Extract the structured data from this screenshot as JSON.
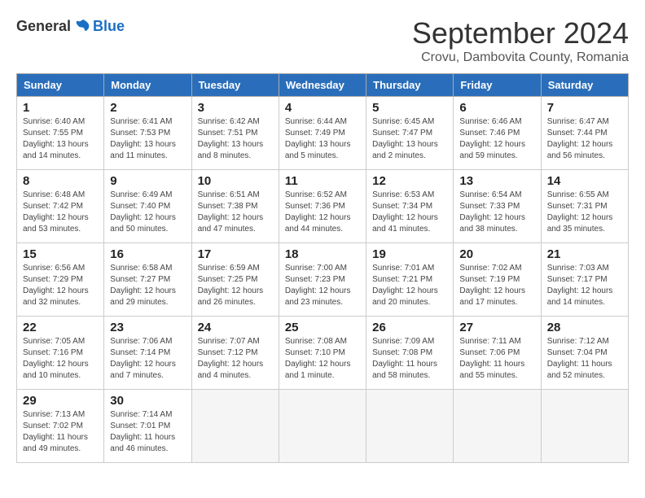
{
  "header": {
    "logo_general": "General",
    "logo_blue": "Blue",
    "month_title": "September 2024",
    "subtitle": "Crovu, Dambovita County, Romania"
  },
  "days_of_week": [
    "Sunday",
    "Monday",
    "Tuesday",
    "Wednesday",
    "Thursday",
    "Friday",
    "Saturday"
  ],
  "weeks": [
    [
      {
        "day": "1",
        "sunrise": "Sunrise: 6:40 AM",
        "sunset": "Sunset: 7:55 PM",
        "daylight": "Daylight: 13 hours and 14 minutes."
      },
      {
        "day": "2",
        "sunrise": "Sunrise: 6:41 AM",
        "sunset": "Sunset: 7:53 PM",
        "daylight": "Daylight: 13 hours and 11 minutes."
      },
      {
        "day": "3",
        "sunrise": "Sunrise: 6:42 AM",
        "sunset": "Sunset: 7:51 PM",
        "daylight": "Daylight: 13 hours and 8 minutes."
      },
      {
        "day": "4",
        "sunrise": "Sunrise: 6:44 AM",
        "sunset": "Sunset: 7:49 PM",
        "daylight": "Daylight: 13 hours and 5 minutes."
      },
      {
        "day": "5",
        "sunrise": "Sunrise: 6:45 AM",
        "sunset": "Sunset: 7:47 PM",
        "daylight": "Daylight: 13 hours and 2 minutes."
      },
      {
        "day": "6",
        "sunrise": "Sunrise: 6:46 AM",
        "sunset": "Sunset: 7:46 PM",
        "daylight": "Daylight: 12 hours and 59 minutes."
      },
      {
        "day": "7",
        "sunrise": "Sunrise: 6:47 AM",
        "sunset": "Sunset: 7:44 PM",
        "daylight": "Daylight: 12 hours and 56 minutes."
      }
    ],
    [
      {
        "day": "8",
        "sunrise": "Sunrise: 6:48 AM",
        "sunset": "Sunset: 7:42 PM",
        "daylight": "Daylight: 12 hours and 53 minutes."
      },
      {
        "day": "9",
        "sunrise": "Sunrise: 6:49 AM",
        "sunset": "Sunset: 7:40 PM",
        "daylight": "Daylight: 12 hours and 50 minutes."
      },
      {
        "day": "10",
        "sunrise": "Sunrise: 6:51 AM",
        "sunset": "Sunset: 7:38 PM",
        "daylight": "Daylight: 12 hours and 47 minutes."
      },
      {
        "day": "11",
        "sunrise": "Sunrise: 6:52 AM",
        "sunset": "Sunset: 7:36 PM",
        "daylight": "Daylight: 12 hours and 44 minutes."
      },
      {
        "day": "12",
        "sunrise": "Sunrise: 6:53 AM",
        "sunset": "Sunset: 7:34 PM",
        "daylight": "Daylight: 12 hours and 41 minutes."
      },
      {
        "day": "13",
        "sunrise": "Sunrise: 6:54 AM",
        "sunset": "Sunset: 7:33 PM",
        "daylight": "Daylight: 12 hours and 38 minutes."
      },
      {
        "day": "14",
        "sunrise": "Sunrise: 6:55 AM",
        "sunset": "Sunset: 7:31 PM",
        "daylight": "Daylight: 12 hours and 35 minutes."
      }
    ],
    [
      {
        "day": "15",
        "sunrise": "Sunrise: 6:56 AM",
        "sunset": "Sunset: 7:29 PM",
        "daylight": "Daylight: 12 hours and 32 minutes."
      },
      {
        "day": "16",
        "sunrise": "Sunrise: 6:58 AM",
        "sunset": "Sunset: 7:27 PM",
        "daylight": "Daylight: 12 hours and 29 minutes."
      },
      {
        "day": "17",
        "sunrise": "Sunrise: 6:59 AM",
        "sunset": "Sunset: 7:25 PM",
        "daylight": "Daylight: 12 hours and 26 minutes."
      },
      {
        "day": "18",
        "sunrise": "Sunrise: 7:00 AM",
        "sunset": "Sunset: 7:23 PM",
        "daylight": "Daylight: 12 hours and 23 minutes."
      },
      {
        "day": "19",
        "sunrise": "Sunrise: 7:01 AM",
        "sunset": "Sunset: 7:21 PM",
        "daylight": "Daylight: 12 hours and 20 minutes."
      },
      {
        "day": "20",
        "sunrise": "Sunrise: 7:02 AM",
        "sunset": "Sunset: 7:19 PM",
        "daylight": "Daylight: 12 hours and 17 minutes."
      },
      {
        "day": "21",
        "sunrise": "Sunrise: 7:03 AM",
        "sunset": "Sunset: 7:17 PM",
        "daylight": "Daylight: 12 hours and 14 minutes."
      }
    ],
    [
      {
        "day": "22",
        "sunrise": "Sunrise: 7:05 AM",
        "sunset": "Sunset: 7:16 PM",
        "daylight": "Daylight: 12 hours and 10 minutes."
      },
      {
        "day": "23",
        "sunrise": "Sunrise: 7:06 AM",
        "sunset": "Sunset: 7:14 PM",
        "daylight": "Daylight: 12 hours and 7 minutes."
      },
      {
        "day": "24",
        "sunrise": "Sunrise: 7:07 AM",
        "sunset": "Sunset: 7:12 PM",
        "daylight": "Daylight: 12 hours and 4 minutes."
      },
      {
        "day": "25",
        "sunrise": "Sunrise: 7:08 AM",
        "sunset": "Sunset: 7:10 PM",
        "daylight": "Daylight: 12 hours and 1 minute."
      },
      {
        "day": "26",
        "sunrise": "Sunrise: 7:09 AM",
        "sunset": "Sunset: 7:08 PM",
        "daylight": "Daylight: 11 hours and 58 minutes."
      },
      {
        "day": "27",
        "sunrise": "Sunrise: 7:11 AM",
        "sunset": "Sunset: 7:06 PM",
        "daylight": "Daylight: 11 hours and 55 minutes."
      },
      {
        "day": "28",
        "sunrise": "Sunrise: 7:12 AM",
        "sunset": "Sunset: 7:04 PM",
        "daylight": "Daylight: 11 hours and 52 minutes."
      }
    ],
    [
      {
        "day": "29",
        "sunrise": "Sunrise: 7:13 AM",
        "sunset": "Sunset: 7:02 PM",
        "daylight": "Daylight: 11 hours and 49 minutes."
      },
      {
        "day": "30",
        "sunrise": "Sunrise: 7:14 AM",
        "sunset": "Sunset: 7:01 PM",
        "daylight": "Daylight: 11 hours and 46 minutes."
      },
      null,
      null,
      null,
      null,
      null
    ]
  ]
}
